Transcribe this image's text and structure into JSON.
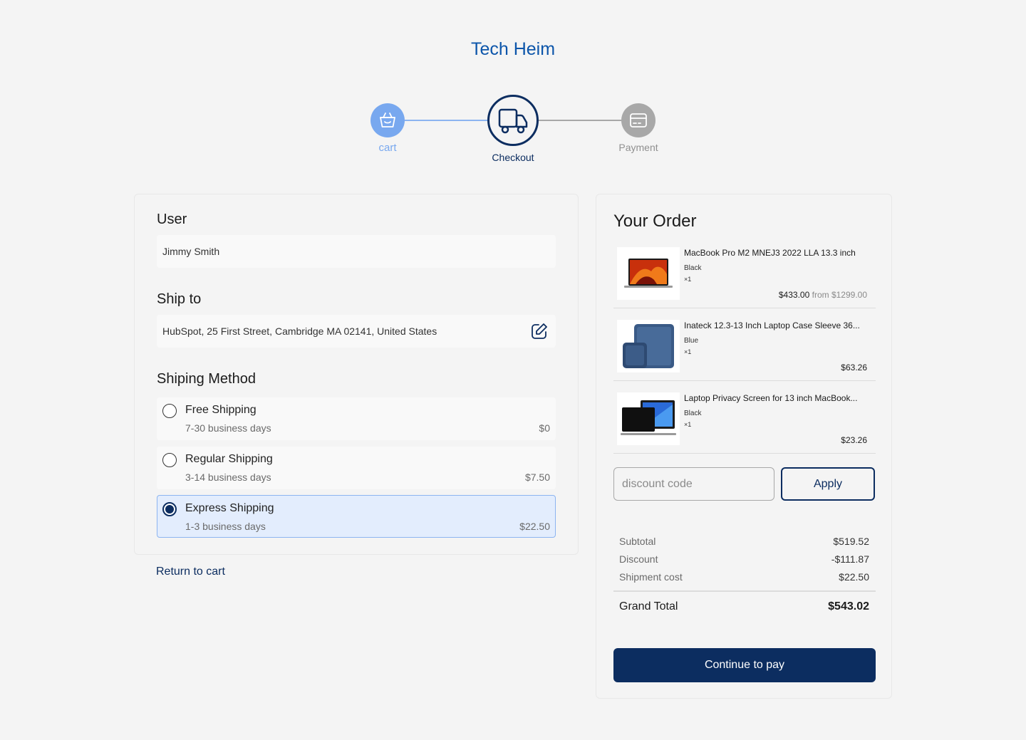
{
  "brand": "Tech Heim",
  "stepper": {
    "steps": [
      {
        "label": "cart",
        "icon": "basket-icon"
      },
      {
        "label": "Checkout",
        "icon": "truck-icon"
      },
      {
        "label": "Payment",
        "icon": "card-icon"
      }
    ],
    "active_step": "Checkout"
  },
  "checkout": {
    "user_title": "User",
    "user_value": "Jimmy Smith",
    "ship_to_title": "Ship to",
    "ship_to_value": "HubSpot, 25 First Street, Cambridge MA 02141, United States",
    "method_title": "Shiping Method",
    "methods": [
      {
        "name": "Free Shipping",
        "days": "7-30 business days",
        "price": "$0",
        "selected": false
      },
      {
        "name": "Regular Shipping",
        "days": "3-14 business days",
        "price": "$7.50",
        "selected": false
      },
      {
        "name": "Express Shipping",
        "days": "1-3 business days",
        "price": "$22.50",
        "selected": true
      }
    ],
    "return_link": "Return to cart"
  },
  "order": {
    "title": "Your Order",
    "items": [
      {
        "name": "MacBook Pro M2 MNEJ3 2022 LLA 13.3 inch",
        "color": "Black",
        "qty": "×1",
        "price": "$433.00",
        "from": "from $1299.00",
        "icon": "laptop-image"
      },
      {
        "name": "Inateck 12.3-13 Inch Laptop Case Sleeve 36...",
        "color": "Blue",
        "qty": "×1",
        "price": "$63.26",
        "from": "",
        "icon": "laptop-sleeve-image"
      },
      {
        "name": "Laptop Privacy Screen for 13 inch MacBook...",
        "color": "Black",
        "qty": "×1",
        "price": "$23.26",
        "from": "",
        "icon": "privacy-screen-image"
      }
    ],
    "discount_placeholder": "discount code",
    "apply_label": "Apply",
    "summary": [
      {
        "label": "Subtotal",
        "value": "$519.52"
      },
      {
        "label": "Discount",
        "value": "-$111.87"
      },
      {
        "label": "Shipment cost",
        "value": "$22.50"
      }
    ],
    "grand_total_label": "Grand Total",
    "grand_total_value": "$543.02",
    "pay_label": "Continue to pay"
  },
  "colors": {
    "brand": "#0c55aa",
    "primary": "#0c2d60",
    "step_done": "#78a8ef",
    "step_todo": "#a8a8a8",
    "selected_bg": "#e3edfd"
  }
}
